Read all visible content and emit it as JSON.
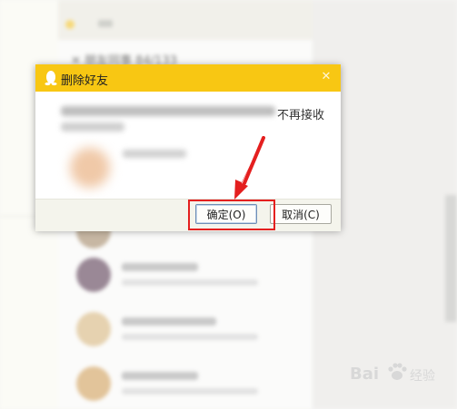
{
  "background": {
    "group_header": "朋友同事 84/133"
  },
  "dialog": {
    "title": "删除好友",
    "message_tail": "不再接收",
    "ok_button": "确定(O)",
    "cancel_button": "取消(C)"
  },
  "watermark": {
    "text": "Bai",
    "text_after_paw": "经验"
  },
  "colors": {
    "titlebar": "#f8c713",
    "annotation_red": "#e41f1f"
  },
  "icons": {
    "app": "qq-penguin-icon",
    "close": "close-icon",
    "annotation": "red-arrow"
  }
}
